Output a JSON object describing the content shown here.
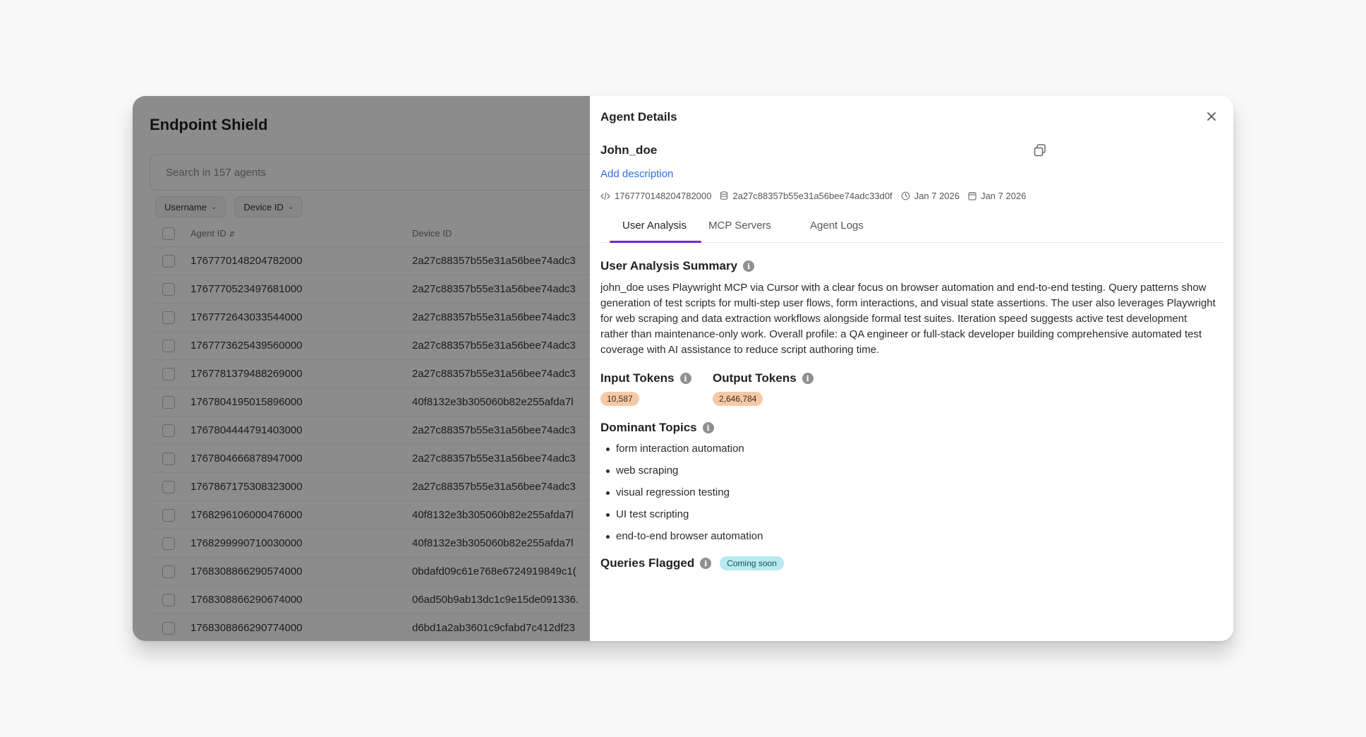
{
  "app": {
    "title": "Endpoint Shield",
    "search_placeholder": "Search in 157 agents",
    "filters": [
      "Username",
      "Device ID"
    ],
    "table": {
      "headers": [
        "Agent ID",
        "Device ID"
      ],
      "rows": [
        [
          "1767770148204782000",
          "2a27c88357b55e31a56bee74adc3"
        ],
        [
          "1767770523497681000",
          "2a27c88357b55e31a56bee74adc3"
        ],
        [
          "1767772643033544000",
          "2a27c88357b55e31a56bee74adc3"
        ],
        [
          "1767773625439560000",
          "2a27c88357b55e31a56bee74adc3"
        ],
        [
          "1767781379488269000",
          "2a27c88357b55e31a56bee74adc3"
        ],
        [
          "1767804195015896000",
          "40f8132e3b305060b82e255afda7l"
        ],
        [
          "1767804444791403000",
          "2a27c88357b55e31a56bee74adc3"
        ],
        [
          "1767804666878947000",
          "2a27c88357b55e31a56bee74adc3"
        ],
        [
          "1767867175308323000",
          "2a27c88357b55e31a56bee74adc3"
        ],
        [
          "1768296106000476000",
          "40f8132e3b305060b82e255afda7l"
        ],
        [
          "1768299990710030000",
          "40f8132e3b305060b82e255afda7l"
        ],
        [
          "1768308866290574000",
          "0bdafd09c61e768e6724919849c1("
        ],
        [
          "1768308866290674000",
          "06ad50b9ab13dc1c9e15de091336."
        ],
        [
          "1768308866290774000",
          "d6bd1a2ab3601c9cfabd7c412df23"
        ]
      ]
    }
  },
  "panel": {
    "title": "Agent Details",
    "agent_name": "John_doe",
    "add_description": "Add description",
    "meta": {
      "agent_id": "1767770148204782000",
      "device_id": "2a27c88357b55e31a56bee74adc33d0f",
      "created": "Jan 7 2026",
      "updated": "Jan 7 2026"
    },
    "tabs": [
      "User Analysis",
      "MCP Servers",
      "Agent Logs"
    ],
    "active_tab": "User Analysis",
    "summary_title": "User Analysis Summary",
    "summary_text": "john_doe uses Playwright MCP via Cursor with a clear focus on browser automation and end-to-end testing. Query patterns show generation of test scripts for multi-step user flows, form interactions, and visual state assertions. The user also leverages Playwright for web scraping and data extraction workflows alongside formal test suites. Iteration speed suggests active test development rather than maintenance-only work. Overall profile: a QA engineer or full-stack developer building comprehensive automated test coverage with AI assistance to reduce script authoring time.",
    "input_tokens_label": "Input Tokens",
    "input_tokens_value": "10,587",
    "output_tokens_label": "Output Tokens",
    "output_tokens_value": "2,646,784",
    "topics_title": "Dominant Topics",
    "topics": [
      "form interaction automation",
      "web scraping",
      "visual regression testing",
      "UI test scripting",
      "end-to-end browser automation"
    ],
    "queries_flagged_title": "Queries Flagged",
    "queries_flagged_badge": "Coming soon"
  },
  "colors": {
    "accent_tab": "#6c2bd9",
    "link": "#2f6ed8",
    "token_badge": "#f6c9a6",
    "coming_soon_badge": "#b6ebef"
  }
}
